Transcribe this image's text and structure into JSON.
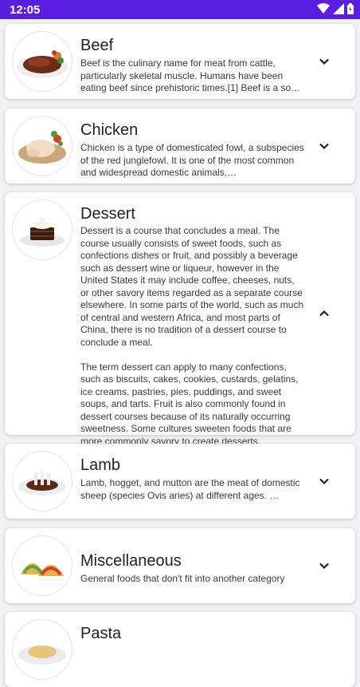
{
  "status_bar": {
    "time": "12:05"
  },
  "categories": [
    {
      "title": "Beef",
      "description": "Beef is the culinary name for meat from cattle, particularly skeletal muscle. Humans have been eating beef since prehistoric times.[1] Beef is a so…",
      "expanded": false,
      "chevron_icon": "chevron-down-icon"
    },
    {
      "title": "Chicken",
      "description": "Chicken is a type of domesticated fowl, a subspecies of the red junglefowl. It is one of the most common and widespread domestic animals,…",
      "expanded": false,
      "chevron_icon": "chevron-down-icon"
    },
    {
      "title": "Dessert",
      "description": "Dessert is a course that concludes a meal. The course usually consists of sweet foods, such as confections dishes or fruit, and possibly a beverage such as dessert wine or liqueur, however in the United States it may include coffee, cheeses, nuts, or other savory items regarded as a separate course elsewhere. In some parts of the world, such as much of central and western Africa, and most parts of China, there is no tradition of a dessert course to conclude a meal.\n\nThe term dessert can apply to many confections, such as biscuits, cakes, cookies, custards, gelatins, ice creams, pastries, pies, puddings, and sweet soups, and tarts. Fruit is also commonly found in dessert courses because of its naturally occurring sweetness. Some cultures sweeten foods that are more commonly savory to create desserts.",
      "expanded": true,
      "chevron_icon": "chevron-up-icon"
    },
    {
      "title": "Lamb",
      "description": "Lamb, hogget, and mutton are the meat of domestic sheep (species Ovis aries) at different ages. …",
      "expanded": false,
      "chevron_icon": "chevron-down-icon"
    },
    {
      "title": "Miscellaneous",
      "description": "General foods that don't fit into another category",
      "expanded": false,
      "chevron_icon": "chevron-down-icon"
    },
    {
      "title": "Pasta",
      "description": "",
      "expanded": false,
      "chevron_icon": "chevron-down-icon"
    }
  ]
}
